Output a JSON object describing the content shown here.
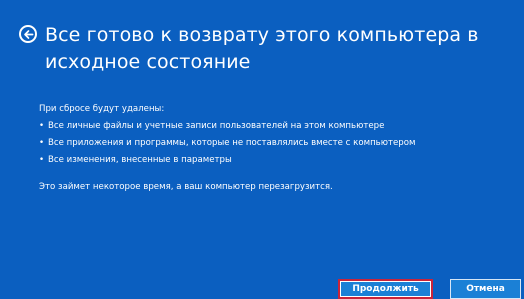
{
  "window": {
    "background": "#0b5fc0",
    "title": "Все готово к возврату этого компьютера в исходное состояние",
    "back_icon": "back-arrow-circle-icon"
  },
  "content": {
    "intro": "При сбросе будут удалены:",
    "bullet": "•",
    "items": [
      "Все личные файлы и учетные записи пользователей на этом компьютере",
      "Все приложения и программы, которые не поставлялись вместе с компьютером",
      "Все изменения, внесенные в параметры"
    ],
    "note": "Это займет некоторое время, а ваш компьютер перезагрузится."
  },
  "buttons": {
    "continue_label": "Продолжить",
    "cancel_label": "Отмена",
    "highlight_color": "#c9243a"
  }
}
